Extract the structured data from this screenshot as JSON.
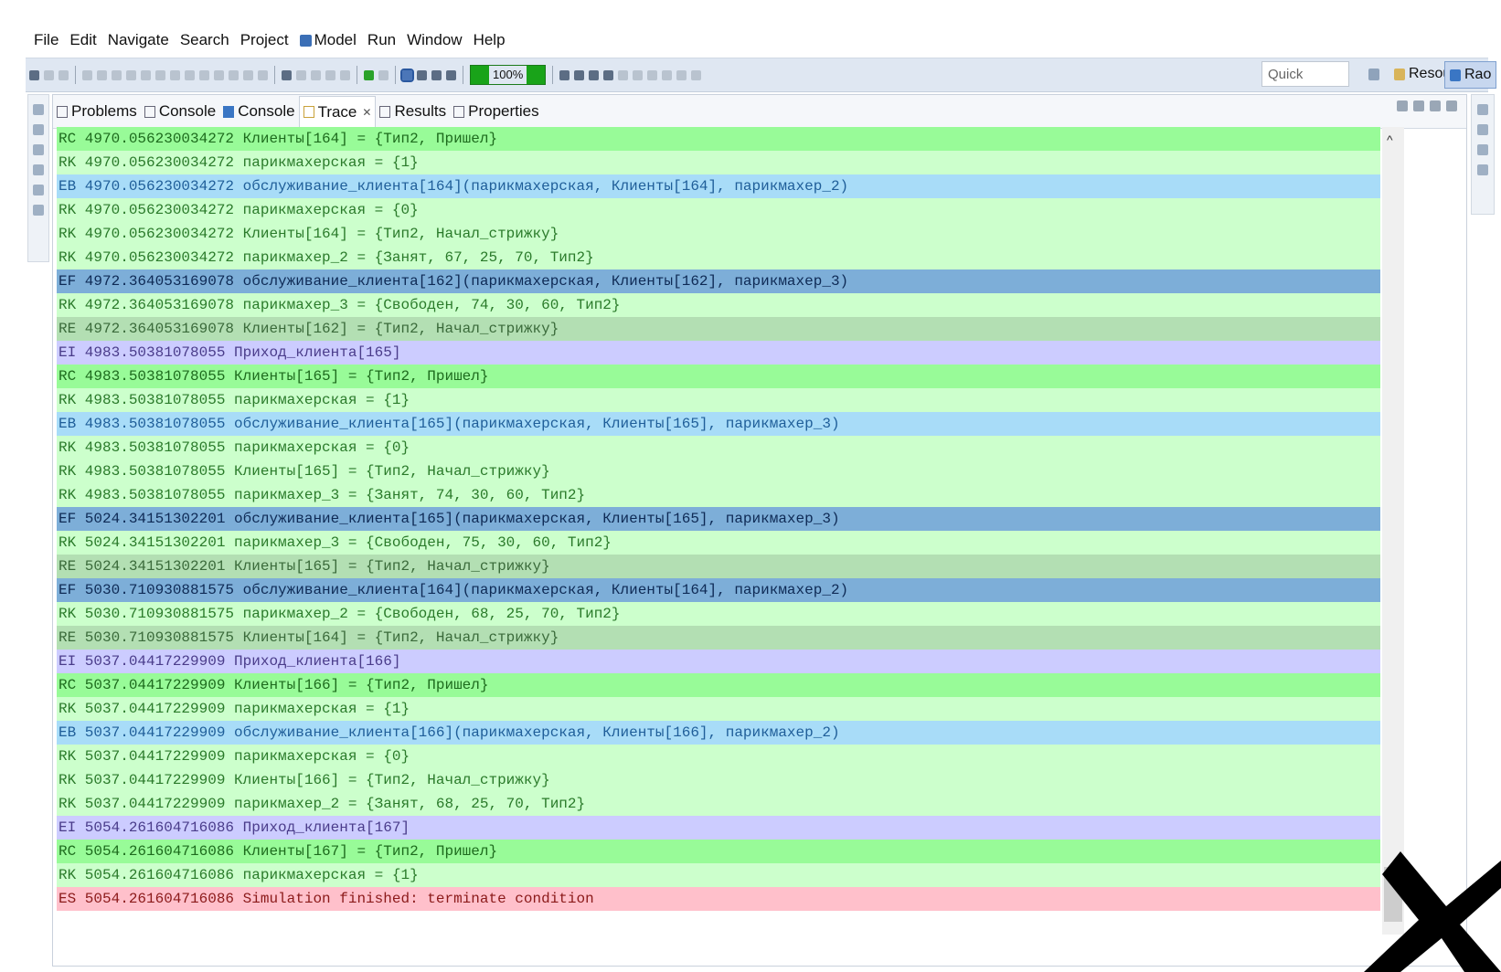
{
  "menu": [
    "File",
    "Edit",
    "Navigate",
    "Search",
    "Project",
    "Model",
    "Run",
    "Window",
    "Help"
  ],
  "toolbar": {
    "speed": "100%",
    "quick_access": "Quick Access",
    "resource_label": "Resource",
    "rao_label": "Rao"
  },
  "tabs": [
    {
      "label": "Problems",
      "icon": "problems-icon"
    },
    {
      "label": "Console",
      "icon": "console-icon"
    },
    {
      "label": "Console",
      "icon": "rao-console-icon"
    },
    {
      "label": "Trace",
      "icon": "trace-icon",
      "active": true
    },
    {
      "label": "Results",
      "icon": "results-icon"
    },
    {
      "label": "Properties",
      "icon": "properties-icon"
    }
  ],
  "colors": {
    "RC": "#98fb98",
    "RK": "#ccffcc",
    "EB": "#a8dcf8",
    "EF": "#7daed8",
    "RE": "#b3dfb3",
    "EI": "#ccccff",
    "ES": "#ffc0cb"
  },
  "trace": [
    {
      "type": "RC",
      "text": "RC 4970.056230034272 Клиенты[164] = {Тип2, Пришел}"
    },
    {
      "type": "RK",
      "text": "RK 4970.056230034272 парикмахерская = {1}"
    },
    {
      "type": "EB",
      "text": "EB 4970.056230034272 обслуживание_клиента[164](парикмахерская, Клиенты[164], парикмахер_2)"
    },
    {
      "type": "RK",
      "text": "RK 4970.056230034272 парикмахерская = {0}"
    },
    {
      "type": "RK",
      "text": "RK 4970.056230034272 Клиенты[164] = {Тип2, Начал_стрижку}"
    },
    {
      "type": "RK",
      "text": "RK 4970.056230034272 парикмахер_2 = {Занят, 67, 25, 70, Тип2}"
    },
    {
      "type": "EF",
      "text": "EF 4972.364053169078 обслуживание_клиента[162](парикмахерская, Клиенты[162], парикмахер_3)"
    },
    {
      "type": "RK",
      "text": "RK 4972.364053169078 парикмахер_3 = {Свободен, 74, 30, 60, Тип2}"
    },
    {
      "type": "RE",
      "text": "RE 4972.364053169078 Клиенты[162] = {Тип2, Начал_стрижку}"
    },
    {
      "type": "EI",
      "text": "EI 4983.50381078055 Приход_клиента[165]"
    },
    {
      "type": "RC",
      "text": "RC 4983.50381078055 Клиенты[165] = {Тип2, Пришел}"
    },
    {
      "type": "RK",
      "text": "RK 4983.50381078055 парикмахерская = {1}"
    },
    {
      "type": "EB",
      "text": "EB 4983.50381078055 обслуживание_клиента[165](парикмахерская, Клиенты[165], парикмахер_3)"
    },
    {
      "type": "RK",
      "text": "RK 4983.50381078055 парикмахерская = {0}"
    },
    {
      "type": "RK",
      "text": "RK 4983.50381078055 Клиенты[165] = {Тип2, Начал_стрижку}"
    },
    {
      "type": "RK",
      "text": "RK 4983.50381078055 парикмахер_3 = {Занят, 74, 30, 60, Тип2}"
    },
    {
      "type": "EF",
      "text": "EF 5024.34151302201 обслуживание_клиента[165](парикмахерская, Клиенты[165], парикмахер_3)"
    },
    {
      "type": "RK",
      "text": "RK 5024.34151302201 парикмахер_3 = {Свободен, 75, 30, 60, Тип2}"
    },
    {
      "type": "RE",
      "text": "RE 5024.34151302201 Клиенты[165] = {Тип2, Начал_стрижку}"
    },
    {
      "type": "EF",
      "text": "EF 5030.710930881575 обслуживание_клиента[164](парикмахерская, Клиенты[164], парикмахер_2)"
    },
    {
      "type": "RK",
      "text": "RK 5030.710930881575 парикмахер_2 = {Свободен, 68, 25, 70, Тип2}"
    },
    {
      "type": "RE",
      "text": "RE 5030.710930881575 Клиенты[164] = {Тип2, Начал_стрижку}"
    },
    {
      "type": "EI",
      "text": "EI 5037.04417229909 Приход_клиента[166]"
    },
    {
      "type": "RC",
      "text": "RC 5037.04417229909 Клиенты[166] = {Тип2, Пришел}"
    },
    {
      "type": "RK",
      "text": "RK 5037.04417229909 парикмахерская = {1}"
    },
    {
      "type": "EB",
      "text": "EB 5037.04417229909 обслуживание_клиента[166](парикмахерская, Клиенты[166], парикмахер_2)"
    },
    {
      "type": "RK",
      "text": "RK 5037.04417229909 парикмахерская = {0}"
    },
    {
      "type": "RK",
      "text": "RK 5037.04417229909 Клиенты[166] = {Тип2, Начал_стрижку}"
    },
    {
      "type": "RK",
      "text": "RK 5037.04417229909 парикмахер_2 = {Занят, 68, 25, 70, Тип2}"
    },
    {
      "type": "EI",
      "text": "EI 5054.261604716086 Приход_клиента[167]"
    },
    {
      "type": "RC",
      "text": "RC 5054.261604716086 Клиенты[167] = {Тип2, Пришел}"
    },
    {
      "type": "RK",
      "text": "RK 5054.261604716086 парикмахерская = {1}"
    },
    {
      "type": "ES",
      "text": "ES 5054.261604716086 Simulation finished: terminate condition"
    }
  ]
}
